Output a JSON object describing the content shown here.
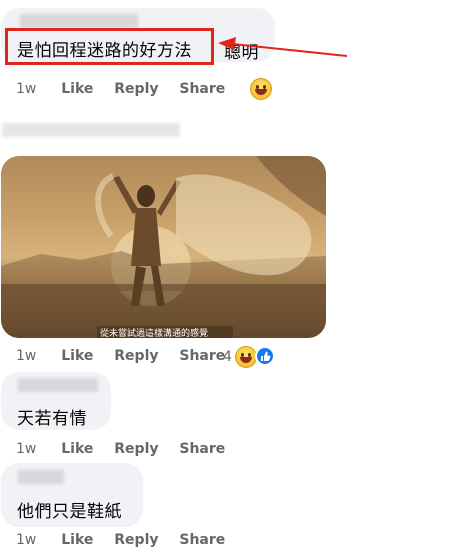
{
  "comments": [
    {
      "text_highlighted": "是怕回程迷路的好方法",
      "text_rest": "聰明",
      "actions": {
        "time": "1w",
        "like": "Like",
        "reply": "Reply",
        "share": "Share"
      }
    },
    {
      "image_caption": "從未嘗試過這樣溝通的感覺",
      "actions": {
        "time": "1w",
        "like": "Like",
        "reply": "Reply",
        "share": "Share"
      },
      "reaction_count": "4"
    },
    {
      "text": "天若有情",
      "actions": {
        "time": "1w",
        "like": "Like",
        "reply": "Reply",
        "share": "Share"
      }
    },
    {
      "text": "他們只是鞋紙",
      "actions": {
        "time": "1w",
        "like": "Like",
        "reply": "Reply",
        "share": "Share"
      }
    }
  ],
  "colors": {
    "annotation_red": "#e0251c",
    "like_blue": "#1877f2",
    "bubble_bg": "#f0f2f5",
    "meta_gray": "#65676b"
  },
  "icons": [
    "laughing-emoji-icon",
    "like-thumb-icon",
    "annotation-arrow-icon"
  ]
}
